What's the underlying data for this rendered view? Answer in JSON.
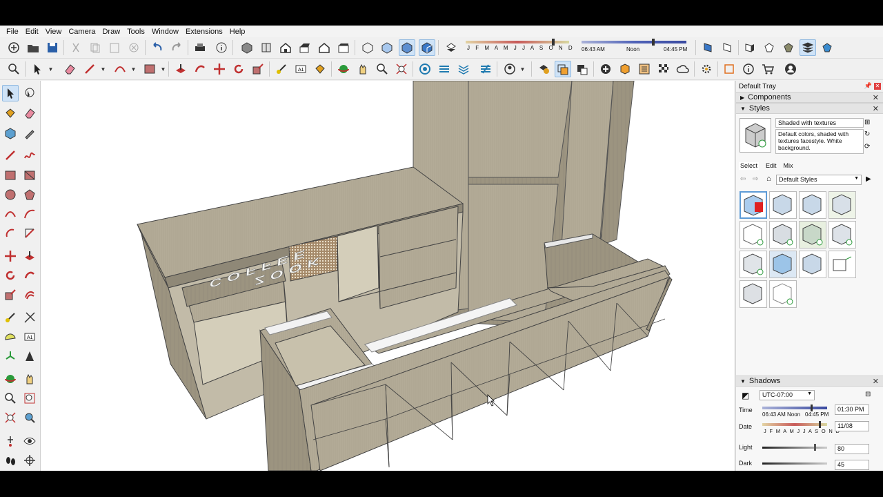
{
  "menu": [
    "File",
    "Edit",
    "View",
    "Camera",
    "Draw",
    "Tools",
    "Window",
    "Extensions",
    "Help"
  ],
  "toolbar": {
    "months": "J F M A M J J A S O N D",
    "time_start": "06:43 AM",
    "time_noon": "Noon",
    "time_end": "04:45 PM"
  },
  "model_text": {
    "line1": "COFFEE",
    "line2": "ZOOK"
  },
  "tray": {
    "title": "Default Tray",
    "components_label": "Components",
    "styles_label": "Styles",
    "style_name": "Shaded with textures",
    "style_desc": "Default colors, shaded with textures facestyle. White background.",
    "tab_select": "Select",
    "tab_edit": "Edit",
    "tab_mix": "Mix",
    "library": "Default Styles",
    "shadows_label": "Shadows",
    "timezone": "UTC-07:00",
    "time_label": "Time",
    "time_value": "01:30 PM",
    "time_start": "06:43 AM",
    "time_noon": "Noon",
    "time_end": "04:45 PM",
    "date_label": "Date",
    "date_value": "11/08",
    "months": "J F M A M J J A S O N D",
    "light_label": "Light",
    "light_value": "80",
    "dark_label": "Dark",
    "dark_value": "45"
  },
  "colors": {
    "wood": "#b3ab97",
    "wood_dark": "#8f8877",
    "accent": "#1e6fbf"
  }
}
